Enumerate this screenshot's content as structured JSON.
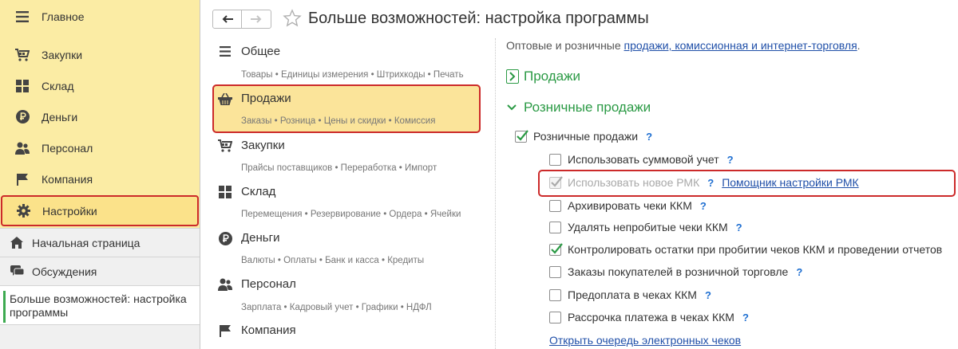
{
  "sidebar": {
    "items": [
      {
        "label": "Главное",
        "icon": "menu-icon"
      },
      {
        "label": "Закупки",
        "icon": "cart-icon"
      },
      {
        "label": "Склад",
        "icon": "warehouse-icon"
      },
      {
        "label": "Деньги",
        "icon": "ruble-icon"
      },
      {
        "label": "Персонал",
        "icon": "people-icon"
      },
      {
        "label": "Компания",
        "icon": "flag-icon"
      },
      {
        "label": "Настройки",
        "icon": "gear-icon"
      }
    ],
    "home": "Начальная страница",
    "discussions": "Обсуждения",
    "open_window": "Больше возможностей: настройка программы"
  },
  "header": {
    "title": "Больше возможностей: настройка программы"
  },
  "sections": [
    {
      "name": "Общее",
      "sub": "Товары • Единицы измерения • Штрихкоды • Печать",
      "icon": "list-icon"
    },
    {
      "name": "Продажи",
      "sub": "Заказы • Розница • Цены и скидки • Комиссия",
      "icon": "basket-icon"
    },
    {
      "name": "Закупки",
      "sub": "Прайсы поставщиков • Переработка • Импорт",
      "icon": "cart-icon"
    },
    {
      "name": "Склад",
      "sub": "Перемещения • Резервирование • Ордера • Ячейки",
      "icon": "warehouse-icon"
    },
    {
      "name": "Деньги",
      "sub": "Валюты • Оплаты • Банк и касса • Кредиты",
      "icon": "ruble-icon"
    },
    {
      "name": "Персонал",
      "sub": "Зарплата • Кадровый учет • Графики • НДФЛ",
      "icon": "people-icon"
    },
    {
      "name": "Компания",
      "sub": "",
      "icon": "flag-icon"
    }
  ],
  "content": {
    "intro_text": "Оптовые и розничные ",
    "intro_link": "продажи, комиссионная и интернет-торговля",
    "intro_end": ".",
    "group_sales": "Продажи",
    "group_retail": "Розничные продажи",
    "retail_checkbox": "Розничные продажи",
    "help": "?",
    "options": [
      {
        "label": "Использовать суммовой учет",
        "checked": false
      },
      {
        "label": "Использовать новое РМК",
        "checked": true,
        "disabled": true,
        "link": "Помощник настройки РМК"
      },
      {
        "label": "Архивировать чеки ККМ",
        "checked": false
      },
      {
        "label": "Удалять непробитые чеки ККМ",
        "checked": false
      },
      {
        "label": "Контролировать остатки при пробитии чеков ККМ и проведении отчетов",
        "checked": true
      },
      {
        "label": "Заказы покупателей в розничной торговле",
        "checked": false
      },
      {
        "label": "Предоплата в чеках ККМ",
        "checked": false
      },
      {
        "label": "Рассрочка платежа в чеках ККМ",
        "checked": false
      }
    ],
    "bottom_link": "Открыть очередь электронных чеков"
  },
  "colors": {
    "sidebar_bg": "#fbeca4",
    "highlight_red": "#cc2a2a",
    "group_green": "#2b9a45",
    "link_blue": "#1f4fa8"
  }
}
